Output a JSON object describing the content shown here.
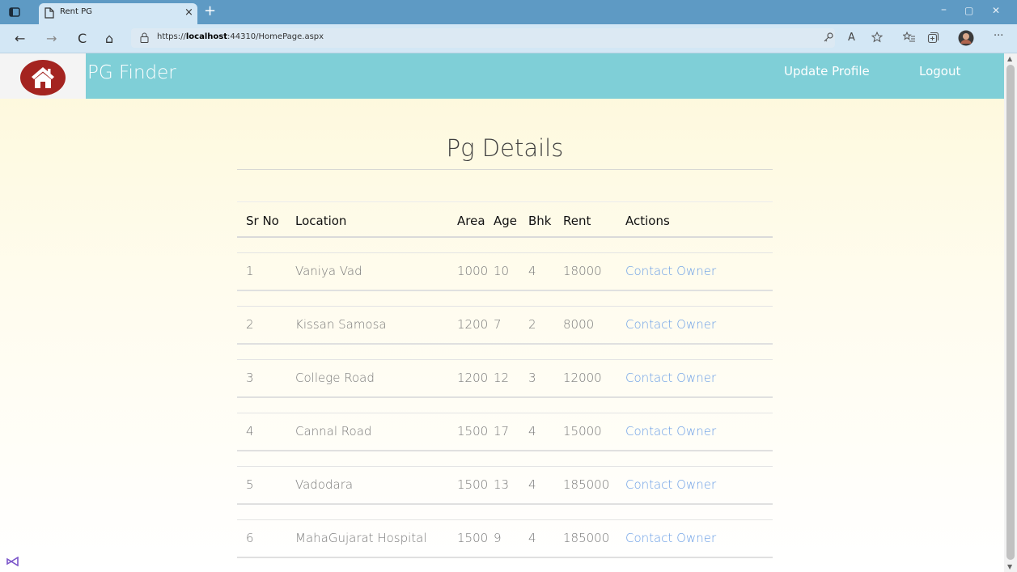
{
  "browser": {
    "tab_title": "Rent PG",
    "tab_close": "×",
    "new_tab": "+",
    "url_prefix": "https://",
    "url_host": "localhost",
    "url_path": ":44310/HomePage.aspx",
    "glyphs": {
      "back": "←",
      "forward": "→",
      "refresh": "C",
      "home": "⌂",
      "minimize": "–",
      "restore": "▢",
      "close": "✕",
      "read_aloud": "A",
      "more": "···"
    }
  },
  "navbar": {
    "brand": "PG Finder",
    "update_profile": "Update Profile",
    "logout": "Logout",
    "color": "#7fcfd7",
    "logo_icon": "home-icon"
  },
  "page": {
    "title": "Pg Details"
  },
  "table": {
    "headers": {
      "sr": "Sr No",
      "location": "Location",
      "area": "Area",
      "age": "Age",
      "bhk": "Bhk",
      "rent": "Rent",
      "actions": "Actions"
    },
    "rows": [
      {
        "sr": "1",
        "location": "Vaniya Vad",
        "area": "1000",
        "age": "10",
        "bhk": "4",
        "rent": "18000",
        "action": "Contact Owner"
      },
      {
        "sr": "2",
        "location": "Kissan Samosa",
        "area": "1200",
        "age": "7",
        "bhk": "2",
        "rent": "8000",
        "action": "Contact Owner"
      },
      {
        "sr": "3",
        "location": "College Road",
        "area": "1200",
        "age": "12",
        "bhk": "3",
        "rent": "12000",
        "action": "Contact Owner"
      },
      {
        "sr": "4",
        "location": "Cannal Road",
        "area": "1500",
        "age": "17",
        "bhk": "4",
        "rent": "15000",
        "action": "Contact Owner"
      },
      {
        "sr": "5",
        "location": "Vadodara",
        "area": "1500",
        "age": "13",
        "bhk": "4",
        "rent": "185000",
        "action": "Contact Owner"
      },
      {
        "sr": "6",
        "location": "MahaGujarat Hospital",
        "area": "1500",
        "age": "9",
        "bhk": "4",
        "rent": "185000",
        "action": "Contact Owner"
      }
    ]
  }
}
